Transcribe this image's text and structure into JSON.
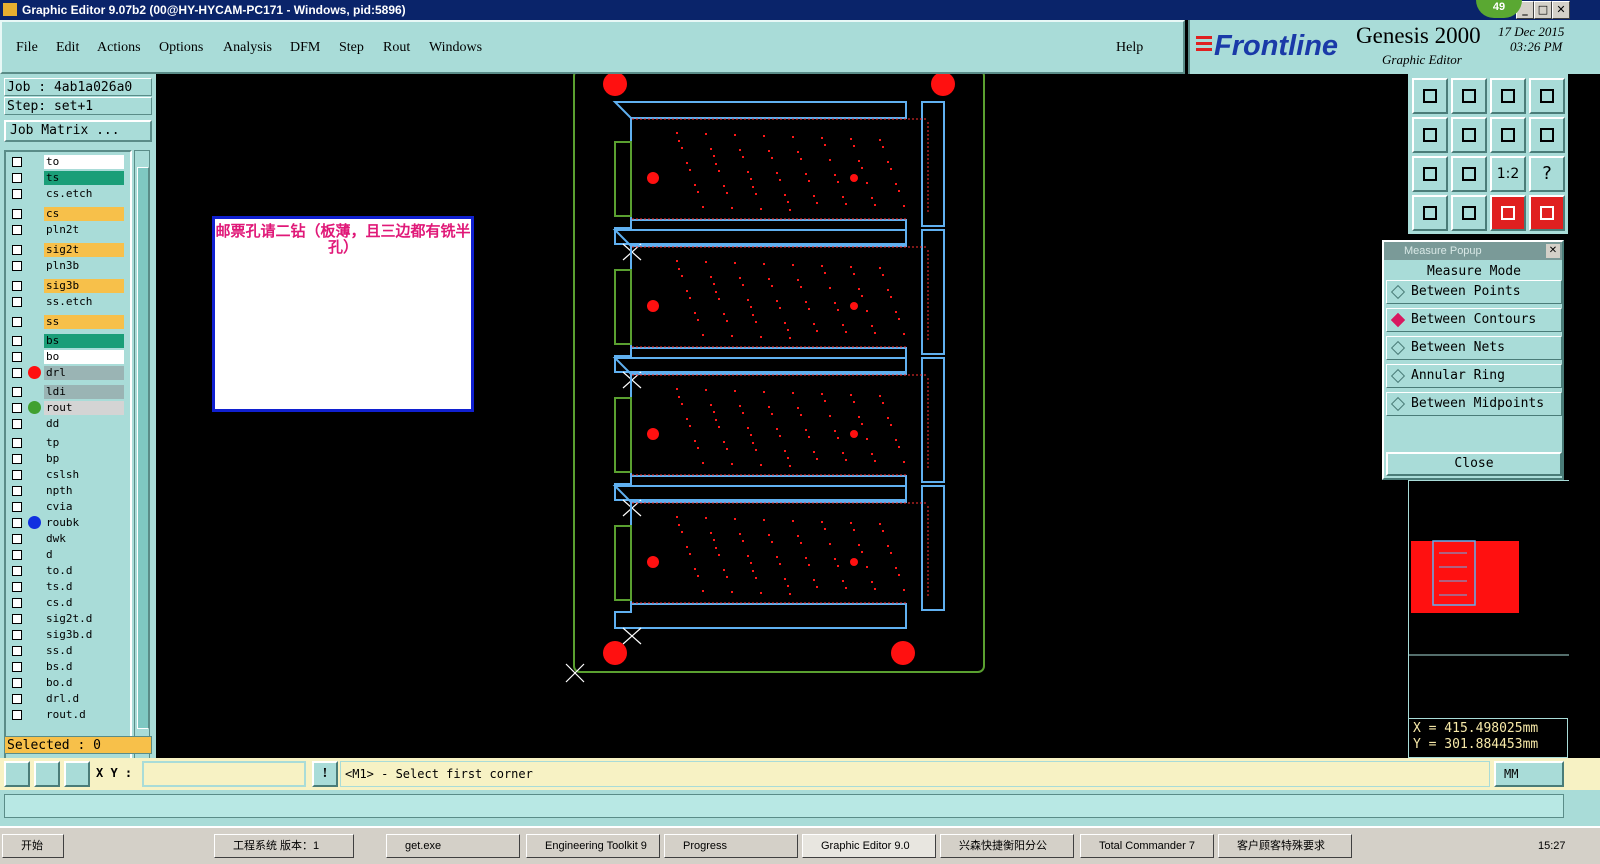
{
  "window": {
    "title": "Graphic Editor 9.07b2 (00@HY-HYCAM-PC171 - Windows, pid:5896)",
    "badge": "49",
    "btn_min": "_",
    "btn_max": "□",
    "btn_close": "✕"
  },
  "menu": {
    "items": [
      "File",
      "Edit",
      "Actions",
      "Options",
      "Analysis",
      "DFM",
      "Step",
      "Rout",
      "Windows"
    ],
    "help": "Help"
  },
  "brand": {
    "logo": "Frontline",
    "product": "Genesis 2000",
    "subtitle": "Graphic Editor",
    "date": "17 Dec 2015",
    "time": "03:26 PM"
  },
  "job": {
    "job_label": "Job  : 4ab1a026a0",
    "step_label": "Step: set+1",
    "matrix_button": "Job Matrix ...",
    "selected": "Selected : 0"
  },
  "layers": [
    {
      "name": "to",
      "color": "#ffffff",
      "dot": ""
    },
    {
      "name": "ts",
      "color": "#1a9e78",
      "dot": ""
    },
    {
      "name": "cs.etch",
      "color": "#a9dcd8",
      "dot": ""
    },
    {
      "name": "cs",
      "color": "#f7c04a",
      "dot": ""
    },
    {
      "name": "pln2t",
      "color": "#a9dcd8",
      "dot": ""
    },
    {
      "name": "sig2t",
      "color": "#f7c04a",
      "dot": ""
    },
    {
      "name": "pln3b",
      "color": "#a9dcd8",
      "dot": ""
    },
    {
      "name": "sig3b",
      "color": "#f7c04a",
      "dot": ""
    },
    {
      "name": "ss.etch",
      "color": "#a9dcd8",
      "dot": ""
    },
    {
      "name": "ss",
      "color": "#f7c04a",
      "dot": ""
    },
    {
      "name": "bs",
      "color": "#1a9e78",
      "dot": ""
    },
    {
      "name": "bo",
      "color": "#ffffff",
      "dot": ""
    },
    {
      "name": "drl",
      "color": "#9ab4b4",
      "dot": "#ff1010"
    },
    {
      "name": "ldi",
      "color": "#9ab4b4",
      "dot": ""
    },
    {
      "name": "rout",
      "color": "#d4d4d4",
      "dot": "#40a030"
    },
    {
      "name": "dd",
      "color": "#a9dcd8",
      "dot": ""
    },
    {
      "name": "tp",
      "color": "#a9dcd8",
      "dot": ""
    },
    {
      "name": "bp",
      "color": "#a9dcd8",
      "dot": ""
    },
    {
      "name": "cslsh",
      "color": "#a9dcd8",
      "dot": ""
    },
    {
      "name": "npth",
      "color": "#a9dcd8",
      "dot": ""
    },
    {
      "name": "cvia",
      "color": "#a9dcd8",
      "dot": ""
    },
    {
      "name": "roubk",
      "color": "#a9dcd8",
      "dot": "#1030e0"
    },
    {
      "name": "dwk",
      "color": "#a9dcd8",
      "dot": ""
    },
    {
      "name": "d",
      "color": "#a9dcd8",
      "dot": ""
    },
    {
      "name": "to.d",
      "color": "#a9dcd8",
      "dot": ""
    },
    {
      "name": "ts.d",
      "color": "#a9dcd8",
      "dot": ""
    },
    {
      "name": "cs.d",
      "color": "#a9dcd8",
      "dot": ""
    },
    {
      "name": "sig2t.d",
      "color": "#a9dcd8",
      "dot": ""
    },
    {
      "name": "sig3b.d",
      "color": "#a9dcd8",
      "dot": ""
    },
    {
      "name": "ss.d",
      "color": "#a9dcd8",
      "dot": ""
    },
    {
      "name": "bs.d",
      "color": "#a9dcd8",
      "dot": ""
    },
    {
      "name": "bo.d",
      "color": "#a9dcd8",
      "dot": ""
    },
    {
      "name": "drl.d",
      "color": "#a9dcd8",
      "dot": ""
    },
    {
      "name": "rout.d",
      "color": "#a9dcd8",
      "dot": ""
    }
  ],
  "note": {
    "text": "邮票孔请二钻（板薄，且三边都有铣半孔）"
  },
  "tools": [
    "move-up-icon",
    "move-down-icon",
    "home-icon",
    "window-icon",
    "move-left-icon",
    "move-right-icon",
    "zoom-back-icon",
    "redraw-icon",
    "fit-vertical-icon",
    "zoom-fit-icon",
    "one-to-two-icon",
    "help-icon",
    "graphic-control-icon",
    "snap-icon",
    "layer-red-1-icon",
    "layer-red-2-icon"
  ],
  "tool_text": {
    "scale": "1:2",
    "help": "?"
  },
  "measure": {
    "title": "Measure Popup",
    "mode_label": "Measure Mode",
    "options": [
      {
        "label": "Between Points",
        "selected": false
      },
      {
        "label": "Between Contours",
        "selected": true
      },
      {
        "label": "Between Nets",
        "selected": false
      },
      {
        "label": "Annular Ring",
        "selected": false
      },
      {
        "label": "Between Midpoints",
        "selected": false
      }
    ],
    "close": "Close",
    "close_x": "✕"
  },
  "coords": {
    "x": "X = 415.498025mm",
    "y": "Y = 301.884453mm"
  },
  "status": {
    "xy_label": "X Y :",
    "xy_value": "",
    "message": "<M1> - Select first corner",
    "units": "MM",
    "alert_icon": "!"
  },
  "taskbar": [
    {
      "label": "开始",
      "icon": "start-icon"
    },
    {
      "label": "工程系统  版本：1",
      "icon": "app-icon"
    },
    {
      "label": "get.exe",
      "icon": "app-icon"
    },
    {
      "label": "Engineering Toolkit 9",
      "icon": "app-icon"
    },
    {
      "label": "Progress",
      "icon": "app-icon"
    },
    {
      "label": "Graphic Editor 9.0",
      "icon": "app-icon"
    },
    {
      "label": "兴森快捷衡阳分公",
      "icon": "app-icon"
    },
    {
      "label": "Total Commander 7",
      "icon": "app-icon"
    },
    {
      "label": "客户顾客特殊要求",
      "icon": "app-icon"
    }
  ],
  "clock": "15:27",
  "colors": {
    "panel": "#a9dcd8",
    "board_outline": "#60b0f0",
    "pad": "#ff1010",
    "rout": "#5aa030",
    "note_border": "#1020d0",
    "note_text": "#e01878"
  }
}
